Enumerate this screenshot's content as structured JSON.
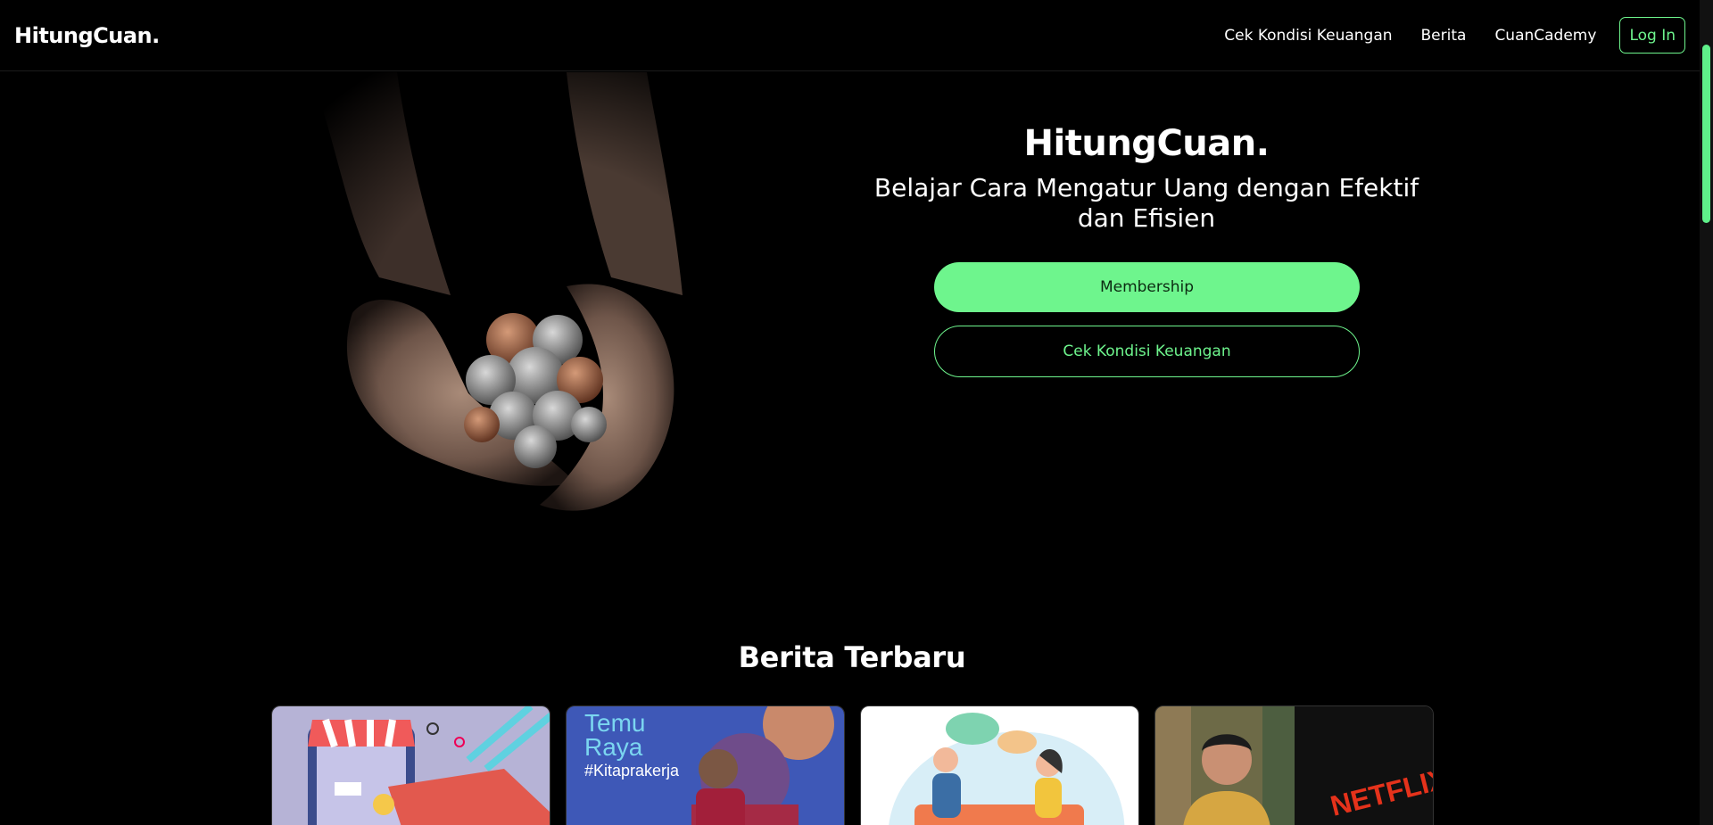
{
  "navbar": {
    "brand": "HitungCuan.",
    "links": [
      "Cek Kondisi Keuangan",
      "Berita",
      "CuanCademy"
    ],
    "login_label": "Log In"
  },
  "hero": {
    "title": "HitungCuan.",
    "subtitle": "Belajar Cara Mengatur Uang dengan Efektif dan Efisien",
    "membership_label": "Membership",
    "cek_label": "Cek Kondisi Keuangan",
    "image_alt": "hands holding coins"
  },
  "news": {
    "title": "Berita Terbaru",
    "cards": [
      {
        "image": "online-shop-illustration"
      },
      {
        "image": "temu-raya-kitaprakerja",
        "overlay_line1": "Temu",
        "overlay_line2": "Raya",
        "overlay_tag": "#Kitaprakerja"
      },
      {
        "image": "conversation-illustration"
      },
      {
        "image": "netflix-founder-photo",
        "overlay_text": "NETFLIX"
      }
    ]
  },
  "colors": {
    "accent": "#6ef58d",
    "background": "#000000"
  }
}
